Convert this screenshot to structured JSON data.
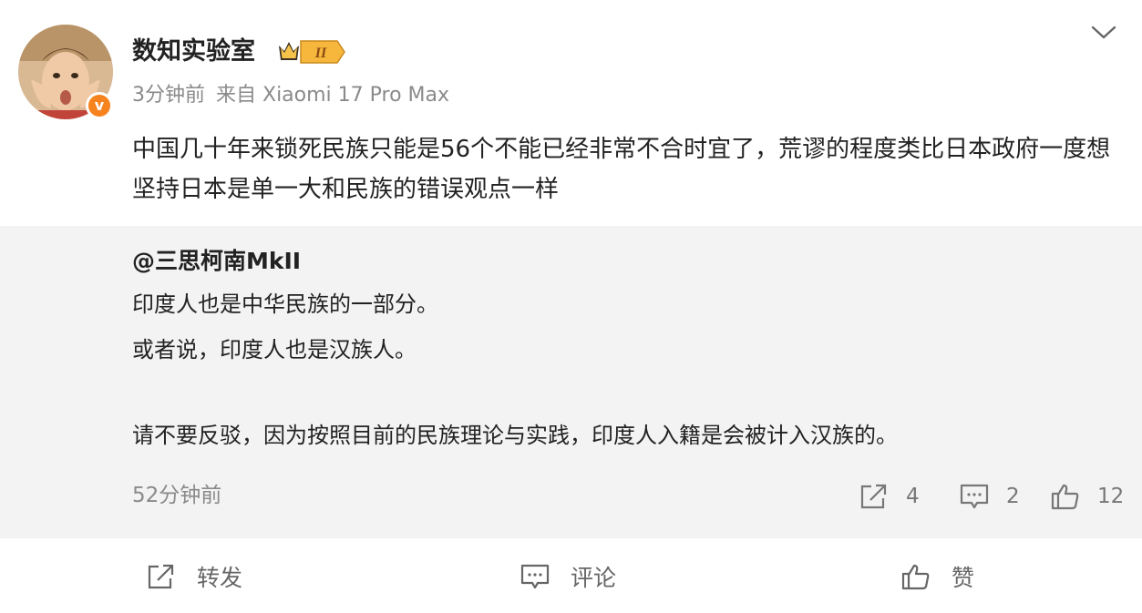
{
  "post": {
    "username": "数知实验室",
    "badge_level": "II",
    "verified_mark": "v",
    "time": "3分钟前",
    "source": "来自 Xiaomi 17 Pro Max",
    "text": "中国几十年来锁死民族只能是56个不能已经非常不合时宜了，荒谬的程度类比日本政府一度想坚持日本是单一大和民族的错误观点一样"
  },
  "quoted": {
    "author": "@三思柯南MkII",
    "lines": [
      "印度人也是中华民族的一部分。",
      "或者说，印度人也是汉族人。",
      "请不要反驳，因为按照目前的民族理论与实践，印度人入籍是会被计入汉族的。"
    ],
    "time": "52分钟前",
    "repost_count": "4",
    "comment_count": "2",
    "like_count": "12"
  },
  "actions": {
    "repost": "转发",
    "comment": "评论",
    "like": "赞"
  },
  "icons": {
    "expand": "chevron-down-icon",
    "repost": "share-icon",
    "comment": "comment-icon",
    "like": "thumbs-up-icon"
  },
  "colors": {
    "verified_badge": "#f7831e",
    "quote_background": "#f3f3f3",
    "meta_text": "#8a8a8a"
  }
}
